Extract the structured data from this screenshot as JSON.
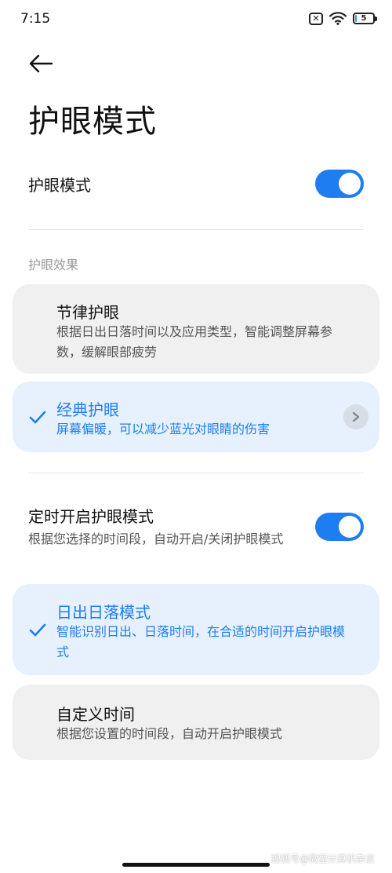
{
  "status": {
    "time": "7:15",
    "battery_level": "5",
    "battery_fraction": 0.05,
    "sim_icon": "no-sim-icon",
    "wifi_icon": "wifi-icon"
  },
  "header": {
    "back_icon": "back-arrow-icon",
    "title": "护眼模式"
  },
  "eye_care": {
    "label": "护眼模式",
    "enabled": true
  },
  "effects": {
    "section_label": "护眼效果",
    "options": [
      {
        "title": "节律护眼",
        "desc": "根据日出日落时间以及应用类型，智能调整屏幕参数，缓解眼部疲劳",
        "selected": false
      },
      {
        "title": "经典护眼",
        "desc": "屏幕偏暖，可以减少蓝光对眼睛的伤害",
        "selected": true
      }
    ]
  },
  "schedule": {
    "label": "定时开启护眼模式",
    "desc": "根据您选择的时间段，自动开启/关闭护眼模式",
    "enabled": true,
    "options": [
      {
        "title": "日出日落模式",
        "desc": "智能识别日出、日落时间，在合适的时间开启护眼模式",
        "selected": true
      },
      {
        "title": "自定义时间",
        "desc": "根据您设置的时间段，自动开启护眼模式",
        "selected": false
      }
    ]
  },
  "watermark": "搜狐号@微型计算机杂志",
  "colors": {
    "accent": "#1f7df2",
    "selected_bg": "#e6f1fd",
    "card_bg": "#f0f0f0"
  }
}
